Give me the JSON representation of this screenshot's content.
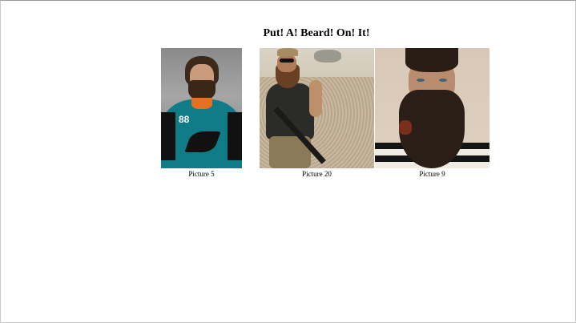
{
  "page": {
    "title": "Put! A! Beard! On! It!"
  },
  "pictures": [
    {
      "caption": "Picture 5"
    },
    {
      "caption": "Picture 20"
    },
    {
      "caption": "Picture 9"
    }
  ],
  "jersey_number": "88"
}
